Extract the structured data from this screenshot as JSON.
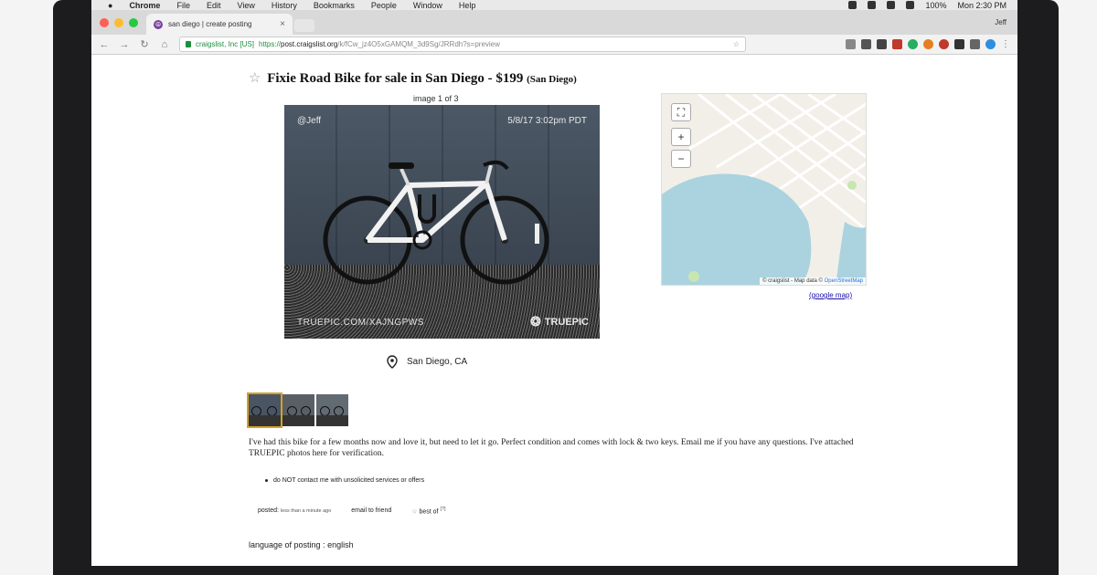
{
  "menubar": {
    "apple": "",
    "app": "Chrome",
    "items": [
      "File",
      "Edit",
      "View",
      "History",
      "Bookmarks",
      "People",
      "Window",
      "Help"
    ],
    "battery": "100%",
    "clock": "Mon 2:30 PM"
  },
  "browser": {
    "tab_title": "san diego | create posting",
    "tab_favicon": "☮",
    "user": "Jeff",
    "secure_label": "craigslist, Inc [US]",
    "url_scheme": "https://",
    "url_host": "post.craigslist.org",
    "url_path": "/k/fCw_jz4O5xGAMQM_3d9Sg/JRRdh?s=preview"
  },
  "posting": {
    "star": "☆",
    "title": "Fixie Road Bike for sale in San Diego - $199",
    "location_suffix": "(San Diego)",
    "image_counter": "image 1 of 3",
    "photo_user": "@Jeff",
    "photo_timestamp": "5/8/17 3:02pm PDT",
    "photo_url": "TRUEPIC.COM/XAJNGPWS",
    "photo_brand": "TRUEPIC",
    "location": "San Diego, CA",
    "google_map": "(google map)",
    "map_attribution_prefix": "© craigslist - Map data ©",
    "map_attribution_link": "OpenStreetMap",
    "description": "I've had this bike for a few months now and love it, but need to let it go. Perfect condition and comes with lock & two keys. Email me if you have any questions. I've attached TRUEPIC photos here for verification.",
    "notice": "do NOT contact me with unsolicited services or offers",
    "posted_label": "posted:",
    "posted_value": "less than a minute ago",
    "email_friend": "email to friend",
    "best_of_star": "☆",
    "best_of": "best of",
    "best_of_sup": "[?]",
    "language": "language of posting : english"
  },
  "colors": {
    "secure": "#1e8e3e",
    "map_water": "#aad3df",
    "link": "#1a0dab"
  }
}
